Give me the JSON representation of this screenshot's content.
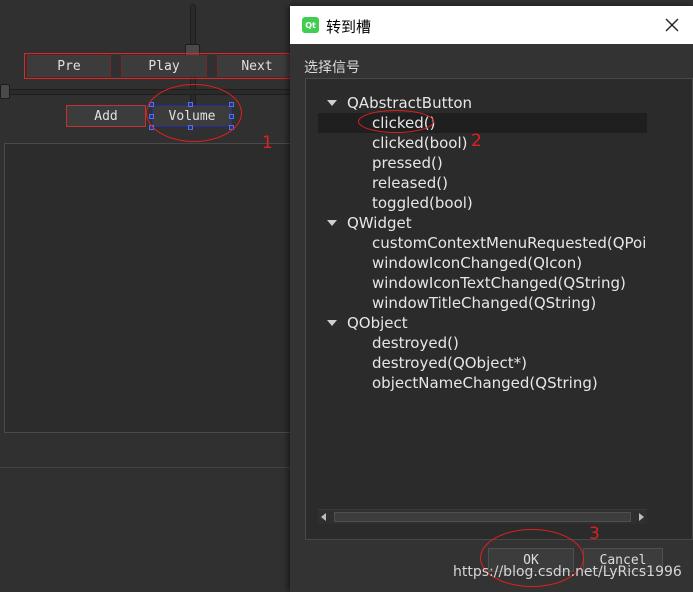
{
  "designer": {
    "buttons": {
      "pre": "Pre",
      "play": "Play",
      "next": "Next",
      "add": "Add",
      "volume": "Volume"
    }
  },
  "annotations": {
    "step1": "1",
    "step2": "2",
    "step3": "3",
    "color": "#e02020"
  },
  "dialog": {
    "title": "转到槽",
    "logo_text": "Qt",
    "signal_label": "选择信号",
    "tree": [
      {
        "label": "QAbstractButton",
        "group": true
      },
      {
        "label": "clicked()",
        "selected": true
      },
      {
        "label": "clicked(bool)"
      },
      {
        "label": "pressed()"
      },
      {
        "label": "released()"
      },
      {
        "label": "toggled(bool)"
      },
      {
        "label": "QWidget",
        "group": true
      },
      {
        "label": "customContextMenuRequested(QPoint)"
      },
      {
        "label": "windowIconChanged(QIcon)"
      },
      {
        "label": "windowIconTextChanged(QString)"
      },
      {
        "label": "windowTitleChanged(QString)"
      },
      {
        "label": "QObject",
        "group": true
      },
      {
        "label": "destroyed()"
      },
      {
        "label": "destroyed(QObject*)"
      },
      {
        "label": "objectNameChanged(QString)"
      }
    ],
    "ok_label": "OK",
    "cancel_label": "Cancel"
  },
  "watermark": "https://blog.csdn.net/LyRics1996"
}
